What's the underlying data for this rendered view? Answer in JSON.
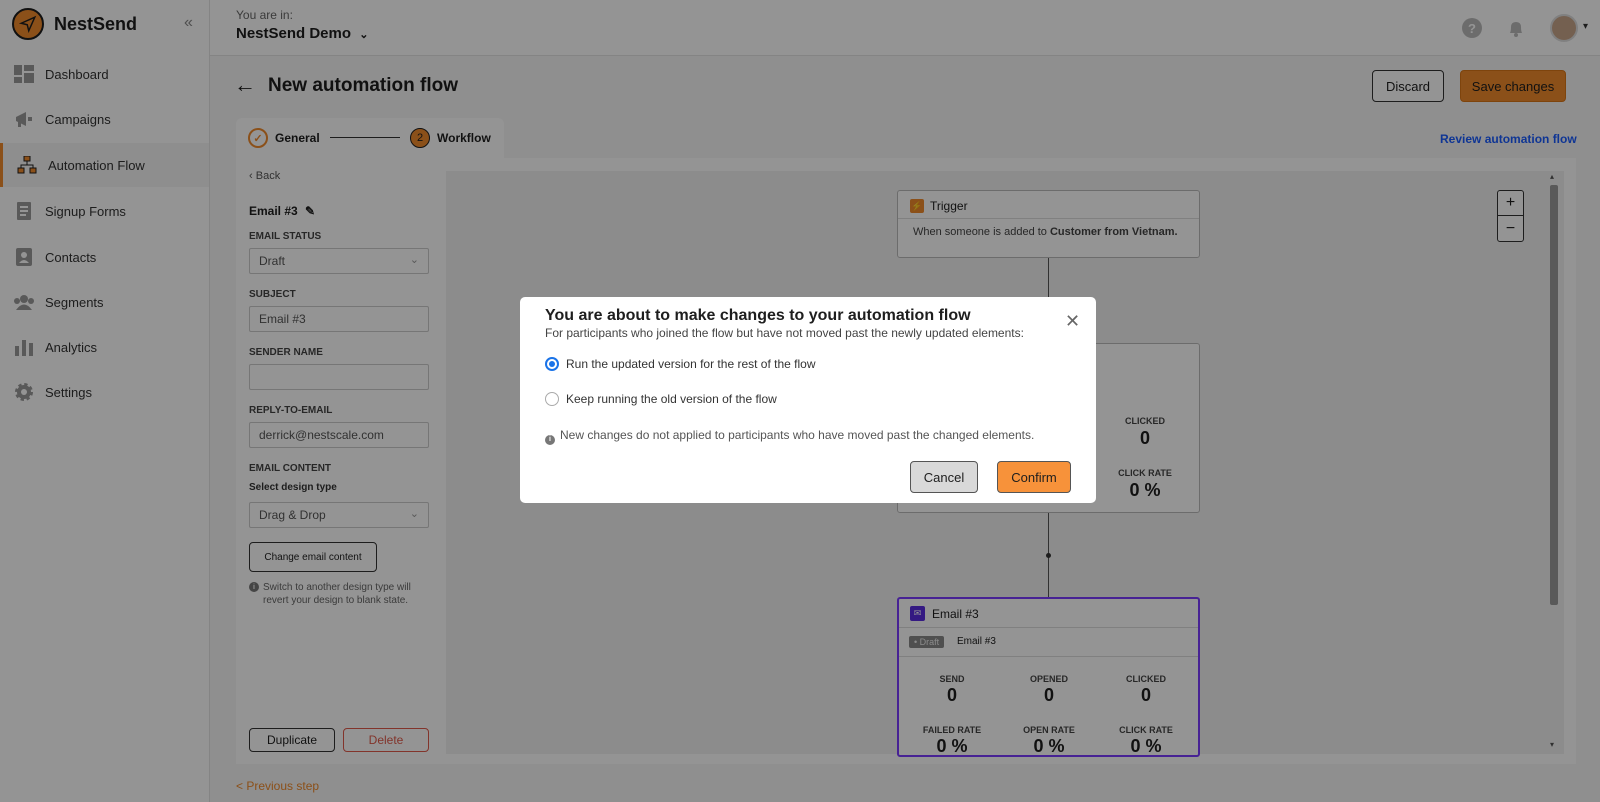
{
  "brand": {
    "name": "NestSend"
  },
  "sidebar": {
    "items": [
      {
        "label": "Dashboard",
        "icon": "dashboard-icon"
      },
      {
        "label": "Campaigns",
        "icon": "megaphone-icon"
      },
      {
        "label": "Automation Flow",
        "icon": "flow-icon",
        "active": true
      },
      {
        "label": "Signup Forms",
        "icon": "form-icon"
      },
      {
        "label": "Contacts",
        "icon": "contacts-icon"
      },
      {
        "label": "Segments",
        "icon": "segments-icon"
      },
      {
        "label": "Analytics",
        "icon": "analytics-icon"
      },
      {
        "label": "Settings",
        "icon": "gear-icon"
      }
    ]
  },
  "topbar": {
    "you_are_in": "You are in:",
    "workspace": "NestSend Demo",
    "help": "?"
  },
  "header": {
    "title": "New automation flow",
    "discard": "Discard",
    "save": "Save changes"
  },
  "stepper": {
    "step1": "General",
    "step2_num": "2",
    "step2": "Workflow",
    "review": "Review automation flow"
  },
  "editor": {
    "back": "Back",
    "email_name": "Email #3",
    "status_label": "EMAIL STATUS",
    "status_value": "Draft",
    "subject_label": "SUBJECT",
    "subject_value": "Email #3",
    "sender_label": "SENDER NAME",
    "sender_value": "",
    "reply_label": "REPLY-TO-EMAIL",
    "reply_value": "derrick@nestscale.com",
    "content_label": "EMAIL CONTENT",
    "design_label": "Select design type",
    "design_value": "Drag & Drop",
    "change_content": "Change email content",
    "hint": "Switch to another design type will revert your design to blank state.",
    "duplicate": "Duplicate",
    "delete": "Delete"
  },
  "canvas": {
    "zoom_in": "+",
    "zoom_out": "−",
    "trigger": {
      "title": "Trigger",
      "text_pre": "When someone is added to ",
      "text_bold": "Customer from Vietnam."
    },
    "node2": {
      "clicked_label": "CLICKED",
      "clicked": "0",
      "click_rate_label": "CLICK RATE",
      "click_rate": "0 %"
    },
    "email3": {
      "title": "Email #3",
      "badge": "Draft",
      "subject": "Email #3",
      "stats": [
        {
          "label": "SEND",
          "value": "0"
        },
        {
          "label": "OPENED",
          "value": "0"
        },
        {
          "label": "CLICKED",
          "value": "0"
        },
        {
          "label": "FAILED RATE",
          "value": "0 %"
        },
        {
          "label": "OPEN RATE",
          "value": "0 %"
        },
        {
          "label": "CLICK RATE",
          "value": "0 %"
        }
      ]
    }
  },
  "prev_step": "< Previous step",
  "modal": {
    "title": "You are about to make changes to your automation flow",
    "subtitle": "For participants who joined the flow but have not moved past the newly updated elements:",
    "option1": "Run the updated version for the rest of the flow",
    "option2": "Keep running the old version of the flow",
    "note": "New changes do not applied to participants who have moved past the changed elements.",
    "cancel": "Cancel",
    "confirm": "Confirm",
    "selected_option": 1
  },
  "colors": {
    "accent": "#f08a2b",
    "link": "#1a5cff",
    "email_node_border": "#7a3cff"
  }
}
